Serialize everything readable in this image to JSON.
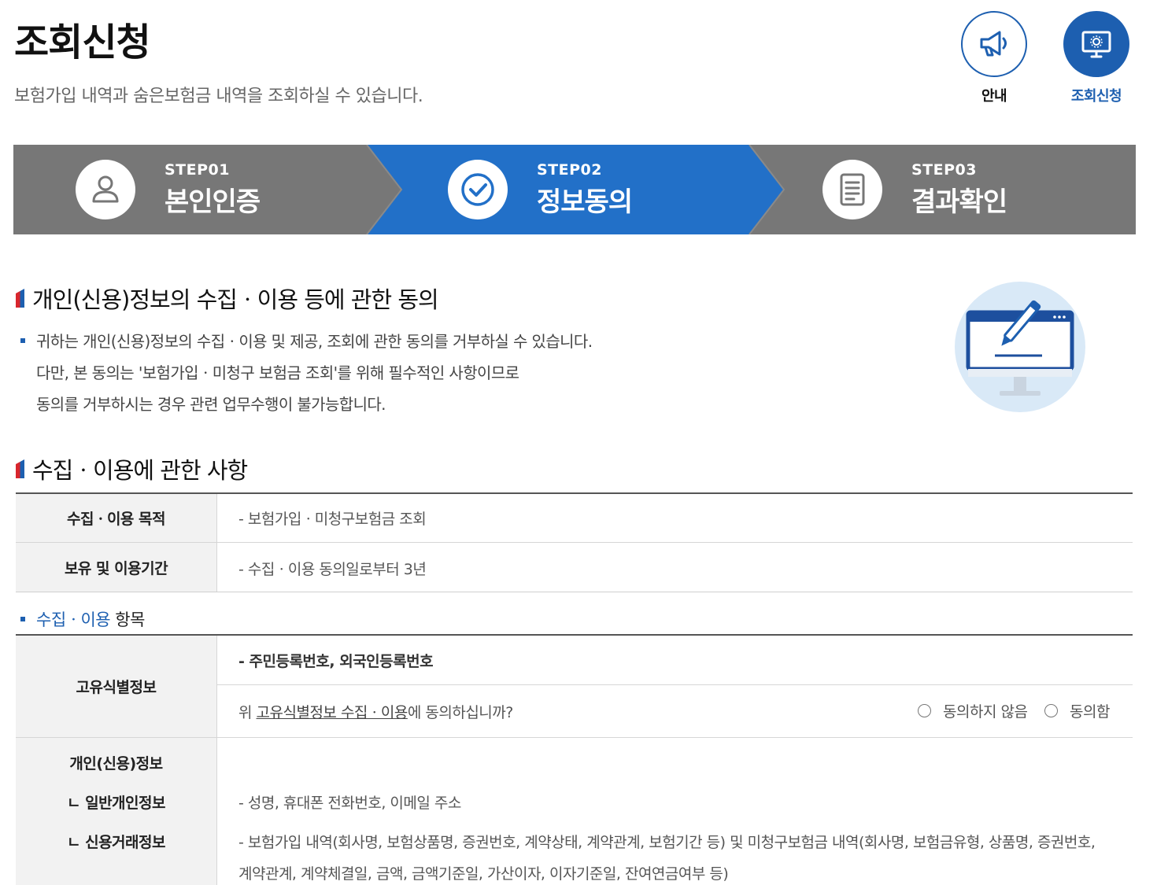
{
  "header": {
    "title": "조회신청",
    "subtitle": "보험가입 내역과 숨은보험금 내역을 조회하실 수 있습니다.",
    "buttons": [
      {
        "label": "안내",
        "icon": "megaphone-icon"
      },
      {
        "label": "조회신청",
        "icon": "monitor-icon"
      }
    ]
  },
  "steps": [
    {
      "num": "STEP01",
      "name": "본인인증",
      "icon": "user-icon",
      "active": false
    },
    {
      "num": "STEP02",
      "name": "정보동의",
      "icon": "check-icon",
      "active": true
    },
    {
      "num": "STEP03",
      "name": "결과확인",
      "icon": "document-icon",
      "active": false
    }
  ],
  "consent": {
    "title": "개인(신용)정보의 수집ㆍ이용 등에 관한 동의",
    "notice": [
      "귀하는 개인(신용)정보의 수집ㆍ이용 및 제공, 조회에 관한 동의를 거부하실 수 있습니다.",
      "다만, 본 동의는 '보험가입ㆍ미청구 보험금 조회'를 위해 필수적인 사항이므로",
      "동의를 거부하시는 경우 관련 업무수행이 불가능합니다."
    ],
    "illustration": "monitor-pen-illustration"
  },
  "usage": {
    "title": "수집ㆍ이용에 관한 사항",
    "rows": [
      {
        "header": "수집ㆍ이용 목적",
        "value": "- 보험가입ㆍ미청구보험금 조회"
      },
      {
        "header": "보유 및 이용기간",
        "value": "- 수집ㆍ이용 동의일로부터 3년"
      }
    ],
    "items_head_blue": "수집ㆍ이용",
    "items_head_rest": " 항목",
    "unique_id": {
      "header": "고유식별정보",
      "value": "- 주민등록번호, 외국인등록번호",
      "question_prefix": "위 ",
      "question_link": "고유식별정보 수집ㆍ이용",
      "question_suffix": "에 동의하십니까?",
      "disagree": "동의하지 않음",
      "agree": "동의함"
    },
    "personal": {
      "header": "개인(신용)정보",
      "sub1": "ㄴ 일반개인정보",
      "sub2": "ㄴ 신용거래정보",
      "general": "- 성명, 휴대폰 전화번호, 이메일 주소",
      "credit_line1": "- 보험가입 내역(회사명, 보험상품명, 증권번호, 계약상태, 계약관계, 보험기간 등) 및 미청구보험금 내역(회사명, 보험금유형, 상품명, 증권번호,",
      "credit_line2": "계약관계, 계약체결일, 금액, 금액기준일, 가산이자, 이자기준일, 잔여연금여부 등)"
    }
  },
  "colors": {
    "accent": "#1d5fb0",
    "step_gray": "#777777",
    "step_active": "#2270c8"
  }
}
